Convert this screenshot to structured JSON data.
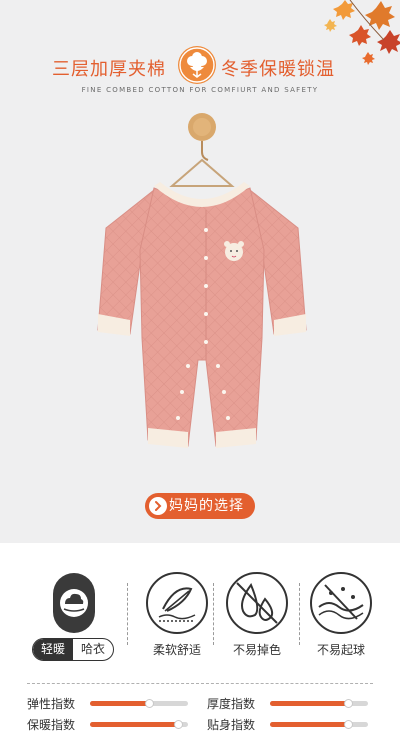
{
  "header": {
    "left_title": "三层加厚夹棉",
    "right_title": "冬季保暖锁温",
    "subtitle": "FINE COMBED COTTON FOR COMFIURT AND SAFETY",
    "badge_icon": "cotton-flower-icon"
  },
  "product": {
    "image": "pink quilted baby romper on wooden hanger"
  },
  "cta": {
    "label": "妈妈的选择",
    "icon": "arrow-right-icon"
  },
  "style_selector": {
    "icon": "cloud-hand-icon",
    "options": [
      "轻暖",
      "哈衣"
    ],
    "selected": "轻暖"
  },
  "features": [
    {
      "label": "柔软舒适",
      "icon": "feather-soft-icon"
    },
    {
      "label": "不易掉色",
      "icon": "no-fading-icon"
    },
    {
      "label": "不易起球",
      "icon": "no-pilling-icon"
    }
  ],
  "meters": [
    {
      "label": "弹性指数",
      "level": 0.6
    },
    {
      "label": "厚度指数",
      "level": 0.8
    },
    {
      "label": "保暖指数",
      "level": 0.9
    },
    {
      "label": "贴身指数",
      "level": 0.8
    }
  ],
  "colors": {
    "accent": "#e35f2f",
    "romper": "#e8a197",
    "background": "#efeff0"
  }
}
